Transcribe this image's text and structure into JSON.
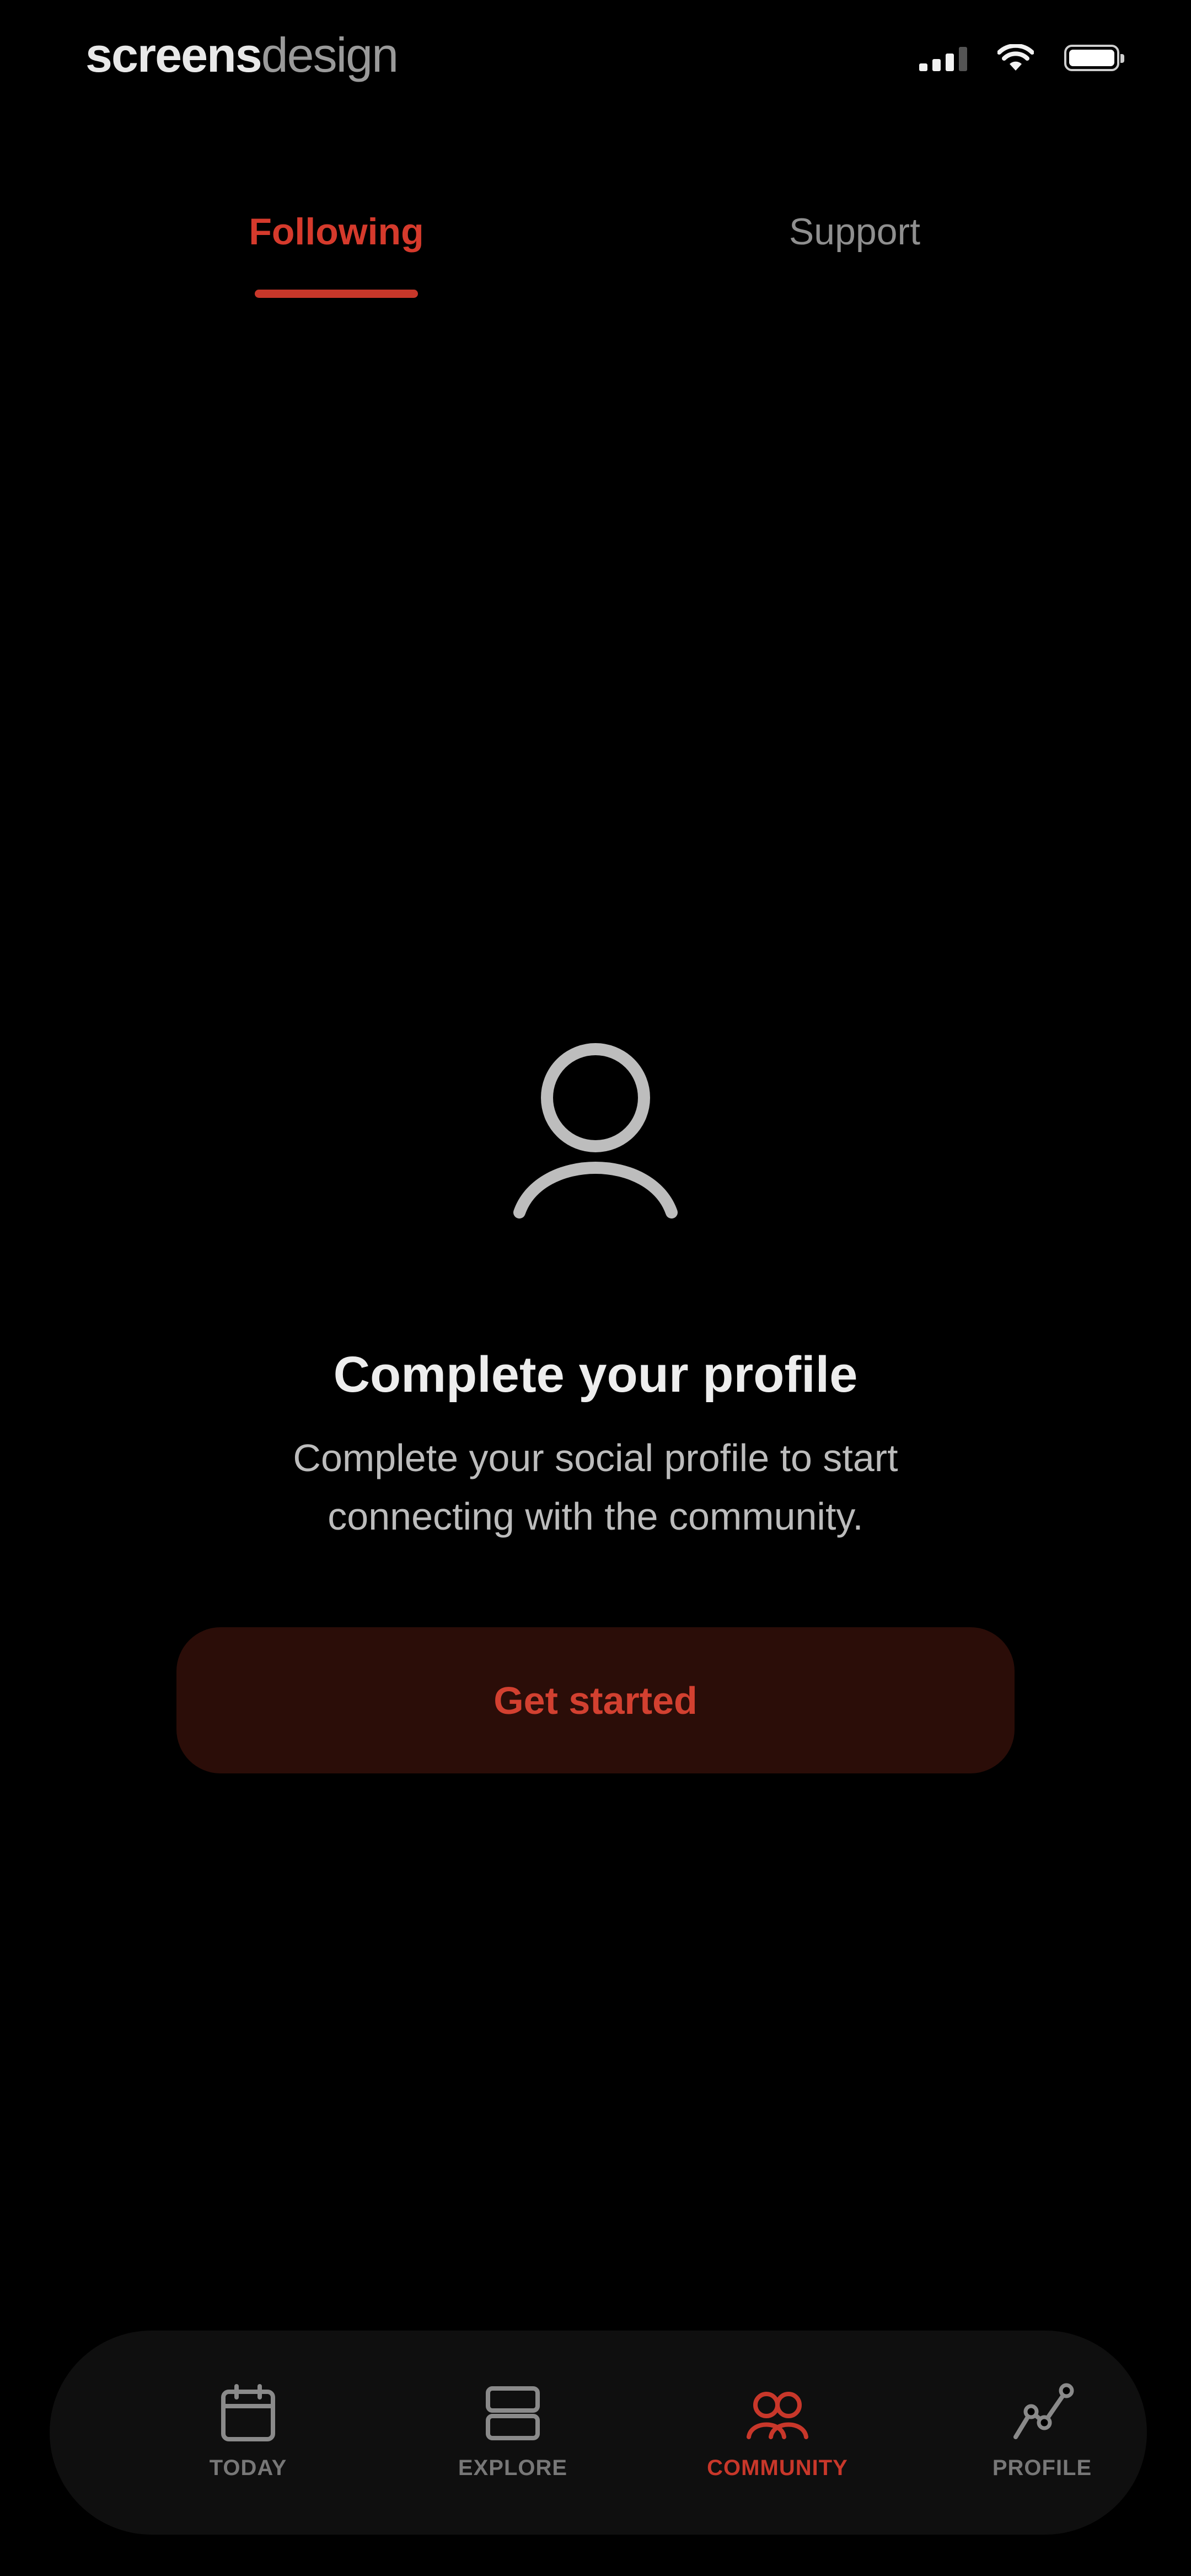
{
  "status_bar": {
    "brand_part1": "screens",
    "brand_part2": "design",
    "icons": [
      "signal-icon",
      "wifi-icon",
      "battery-icon"
    ]
  },
  "tabs": [
    {
      "label": "Following",
      "active": true
    },
    {
      "label": "Support",
      "active": false
    }
  ],
  "empty_state": {
    "icon": "user-icon",
    "title": "Complete your profile",
    "description": "Complete your social profile to start connecting with the community.",
    "button_label": "Get started"
  },
  "bottom_nav": [
    {
      "label": "TODAY",
      "icon": "calendar-icon",
      "active": false
    },
    {
      "label": "EXPLORE",
      "icon": "cards-icon",
      "active": false
    },
    {
      "label": "COMMUNITY",
      "icon": "community-icon",
      "active": true
    },
    {
      "label": "PROFILE",
      "icon": "chart-line-icon",
      "active": false
    }
  ],
  "colors": {
    "background": "#000000",
    "accent": "#c8372a",
    "button_bg": "#2b0d08",
    "muted_text": "#8f8f8f"
  }
}
